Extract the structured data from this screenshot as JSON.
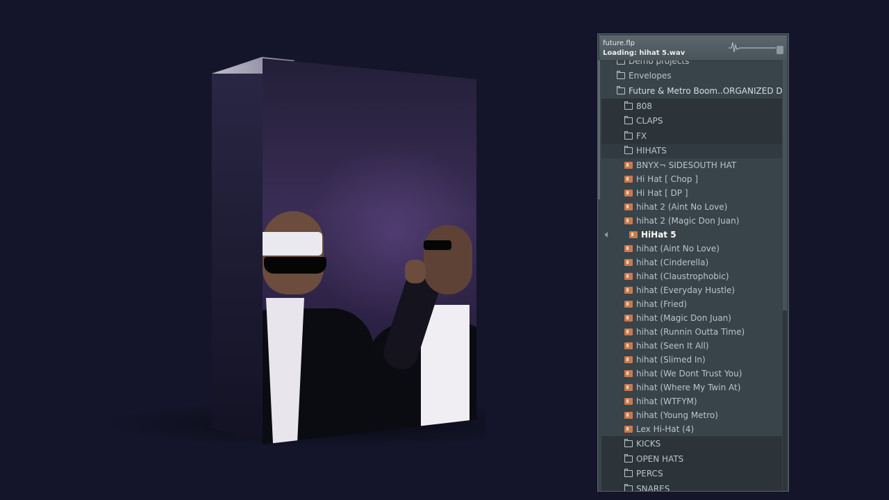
{
  "browser": {
    "hint": {
      "project": "future.flp",
      "status": "Loading: hihat 5.wav"
    },
    "tree": [
      {
        "label": "Demo projects",
        "type": "folder",
        "level": 0
      },
      {
        "label": "Envelopes",
        "type": "folder",
        "level": 0
      },
      {
        "label": "Future & Metro Boom..ORGANIZED Drum Kit",
        "type": "folder-open",
        "level": 0
      },
      {
        "label": "808",
        "type": "folder",
        "level": 1
      },
      {
        "label": "CLAPS",
        "type": "folder",
        "level": 1
      },
      {
        "label": "FX",
        "type": "folder",
        "level": 1
      },
      {
        "label": "HIHATS",
        "type": "folder-open",
        "level": 1
      },
      {
        "label": "BNYX¬ SIDESOUTH HAT",
        "type": "file",
        "level": 2
      },
      {
        "label": "Hi Hat [ Chop ]",
        "type": "file",
        "level": 2
      },
      {
        "label": "Hi Hat [ DP ]",
        "type": "file",
        "level": 2
      },
      {
        "label": "hihat 2 (Aint No Love)",
        "type": "file",
        "level": 2
      },
      {
        "label": "hihat 2 (Magic Don Juan)",
        "type": "file",
        "level": 2
      },
      {
        "label": "HiHat 5",
        "type": "file",
        "level": 2,
        "active": true
      },
      {
        "label": "hihat (Aint No Love)",
        "type": "file",
        "level": 2
      },
      {
        "label": "hihat (Cinderella)",
        "type": "file",
        "level": 2
      },
      {
        "label": "hihat (Claustrophobic)",
        "type": "file",
        "level": 2
      },
      {
        "label": "hihat (Everyday Hustle)",
        "type": "file",
        "level": 2
      },
      {
        "label": "hihat (Fried)",
        "type": "file",
        "level": 2
      },
      {
        "label": "hihat (Magic Don Juan)",
        "type": "file",
        "level": 2
      },
      {
        "label": "hihat (Runnin Outta Time)",
        "type": "file",
        "level": 2
      },
      {
        "label": "hihat (Seen It All)",
        "type": "file",
        "level": 2
      },
      {
        "label": "hihat (Slimed In)",
        "type": "file",
        "level": 2
      },
      {
        "label": "hihat (We Dont Trust You)",
        "type": "file",
        "level": 2
      },
      {
        "label": "hihat (Where My Twin At)",
        "type": "file",
        "level": 2
      },
      {
        "label": "hihat (WTFYM)",
        "type": "file",
        "level": 2
      },
      {
        "label": "hihat (Young Metro)",
        "type": "file",
        "level": 2
      },
      {
        "label": "Lex Hi-Hat (4)",
        "type": "file",
        "level": 2
      },
      {
        "label": "KICKS",
        "type": "folder",
        "level": 1
      },
      {
        "label": "OPEN HATS",
        "type": "folder",
        "level": 1
      },
      {
        "label": "PERCS",
        "type": "folder",
        "level": 1
      },
      {
        "label": "SNARES",
        "type": "folder",
        "level": 1
      }
    ]
  },
  "colors": {
    "background": "#14152a",
    "panel": "#39434a",
    "text": "#b9c6ca",
    "file_icon": "#c87a4e"
  }
}
